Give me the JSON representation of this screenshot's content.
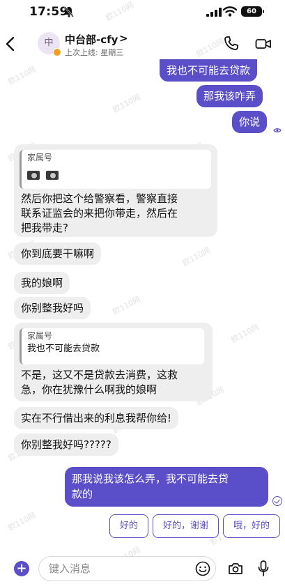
{
  "status_bar": {
    "time": "17:59",
    "battery": "60"
  },
  "header": {
    "back": "<",
    "avatar_text": "中",
    "contact_name": "中台部-cfy",
    "contact_chevron": ">",
    "last_seen": "上次上线: 星期三"
  },
  "messages": {
    "out1": "我也不可能去贷款",
    "out2": "那我该咋弄",
    "out3": "你说",
    "in1_quote_title": "家属号",
    "in1_line1": "然后你把这个给警察看，警察直接",
    "in1_line2": "联系证监会的来把你带走，然后在",
    "in1_line3": "把我带走?",
    "in2": "你到底要干嘛啊",
    "in3": "我的娘啊",
    "in4": "你别整我好吗",
    "in5_quote_title": "家属号",
    "in5_quote_body": "我也不可能去贷款",
    "in5_line1": "不是，这又不是贷款去消费，这救",
    "in5_line2": "急，你在犹豫什么啊我的娘啊",
    "in6": "实在不行借出来的利息我帮你给!",
    "in7": "你别整我好吗?????",
    "out4_line1": "那我说我该怎么弄，我不可能去贷",
    "out4_line2": "款的"
  },
  "quick_replies": [
    "好的",
    "好的，谢谢",
    "哦，好的"
  ],
  "input": {
    "placeholder": "键入消息"
  },
  "colors": {
    "accent": "#5a4fc8",
    "incoming": "#eeeeef"
  },
  "icons": [
    "back-icon",
    "phone-icon",
    "video-icon",
    "plus-icon",
    "emoji-icon",
    "camera-icon",
    "microphone-icon",
    "bell-off-icon",
    "signal-icon",
    "wifi-icon"
  ]
}
